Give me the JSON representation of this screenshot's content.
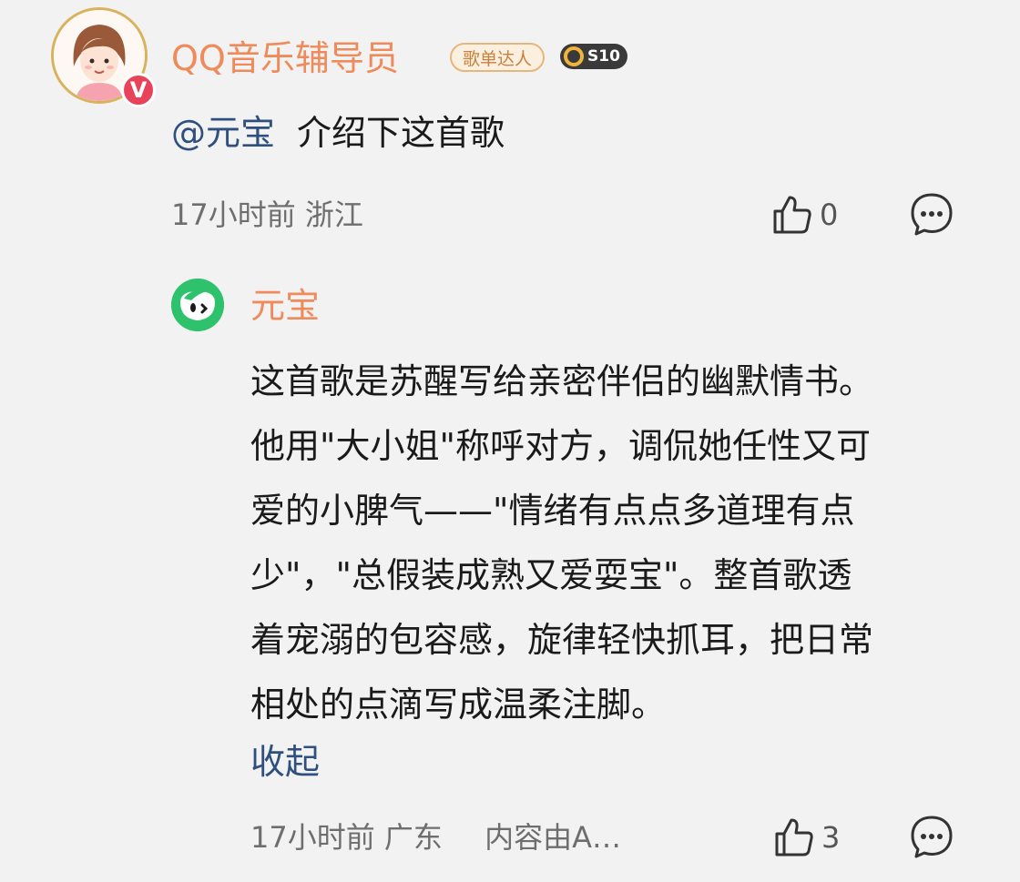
{
  "comment": {
    "username": "QQ音乐辅导员",
    "badge_title": "歌单达人",
    "badge_level": "S10",
    "verified_badge": "V",
    "mention": "@元宝",
    "text": "介绍下这首歌",
    "time": "17小时前",
    "location": "浙江",
    "like_count": "0"
  },
  "reply": {
    "username": "元宝",
    "lines": [
      "这首歌是苏醒写给亲密伴侣的幽默情书。",
      "他用\"大小姐\"称呼对方，调侃她任性又可",
      "爱的小脾气——\"情绪有点点多道理有点",
      "少\"，\"总假装成熟又爱耍宝\"。整首歌透",
      "着宠溺的包容感，旋律轻快抓耳，把日常",
      "相处的点滴写成温柔注脚。"
    ],
    "collapse_label": "收起",
    "time": "17小时前",
    "location": "广东",
    "source_note": "内容由A…",
    "like_count": "3"
  },
  "colors": {
    "username": "#ef8a5a",
    "link": "#2f4f7f",
    "meta": "#6e6e6e",
    "background": "#f2f2f2"
  },
  "icons": [
    "thumbs-up-icon",
    "comment-bubble-icon",
    "verified-v-icon"
  ]
}
